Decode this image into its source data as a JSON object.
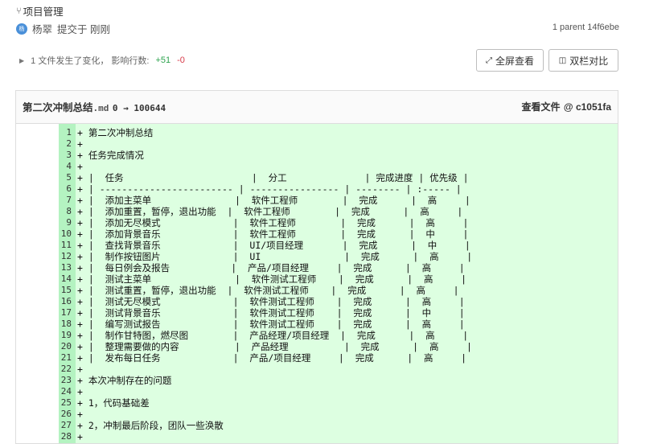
{
  "commit": {
    "icon": "branch-icon",
    "title": "项目管理",
    "avatar_text": "杨",
    "author": "杨翠",
    "committed_text": "提交于 刚刚",
    "parent_text": "1 parent 14f6ebe"
  },
  "summary": {
    "text": "1 文件发生了变化， 影响行数:",
    "additions": "+51",
    "deletions": "-0"
  },
  "buttons": {
    "fullscreen": "全屏查看",
    "split": "双栏对比"
  },
  "file": {
    "name": "第二次冲制总结",
    "ext": ".md",
    "mode_change": "0 → 100644",
    "view_file": "查看文件",
    "sha": "@ c1051fa"
  },
  "diff_lines": [
    {
      "num": "1",
      "text": "+ 第二次冲制总结"
    },
    {
      "num": "2",
      "text": "+"
    },
    {
      "num": "3",
      "text": "+ 任务完成情况"
    },
    {
      "num": "4",
      "text": "+"
    },
    {
      "num": "5",
      "text": "+ |  任务                       |  分工              | 完成进度 | 优先级 |"
    },
    {
      "num": "6",
      "text": "+ | ------------------------ | ---------------- | -------- | :----- |"
    },
    {
      "num": "7",
      "text": "+ |  添加主菜单               |  软件工程师        |  完成      |  高     |"
    },
    {
      "num": "8",
      "text": "+ |  添加重置，暂停，退出功能  |  软件工程师        |  完成      |  高     |"
    },
    {
      "num": "9",
      "text": "+ |  添加无尽模式             |  软件工程师        |  完成      |  高     |"
    },
    {
      "num": "10",
      "text": "+ |  添加背景音乐             |  软件工程师        |  完成      |  中     |"
    },
    {
      "num": "11",
      "text": "+ |  查找背景音乐             |  UI/项目经理       |  完成      |  中     |"
    },
    {
      "num": "12",
      "text": "+ |  制作按钮图片             |  UI               |  完成      |  高     |"
    },
    {
      "num": "13",
      "text": "+ |  每日例会及报告           |  产品/项目经理     |  完成      |  高     |"
    },
    {
      "num": "14",
      "text": "+ |  测试主菜单               |  软件测试工程师    |  完成      |  高     |"
    },
    {
      "num": "15",
      "text": "+ |  测试重置，暂停，退出功能  |  软件测试工程师    |  完成      |  高     |"
    },
    {
      "num": "16",
      "text": "+ |  测试无尽模式             |  软件测试工程师    |  完成      |  高     |"
    },
    {
      "num": "17",
      "text": "+ |  测试背景音乐             |  软件测试工程师    |  完成      |  中     |"
    },
    {
      "num": "18",
      "text": "+ |  编写测试报告             |  软件测试工程师    |  完成      |  高     |"
    },
    {
      "num": "19",
      "text": "+ |  制作甘特图，燃尽图        |  产品经理/项目经理  |  完成      |  高     |"
    },
    {
      "num": "20",
      "text": "+ |  整理需要做的内容          |  产品经理          |  完成      |  高     |"
    },
    {
      "num": "21",
      "text": "+ |  发布每日任务             |  产品/项目经理     |  完成      |  高     |"
    },
    {
      "num": "22",
      "text": "+"
    },
    {
      "num": "23",
      "text": "+ 本次冲制存在的问题"
    },
    {
      "num": "24",
      "text": "+"
    },
    {
      "num": "25",
      "text": "+ 1，代码基础差"
    },
    {
      "num": "26",
      "text": "+"
    },
    {
      "num": "27",
      "text": "+ 2，冲制最后阶段，团队一些涣散"
    },
    {
      "num": "28",
      "text": "+"
    }
  ]
}
